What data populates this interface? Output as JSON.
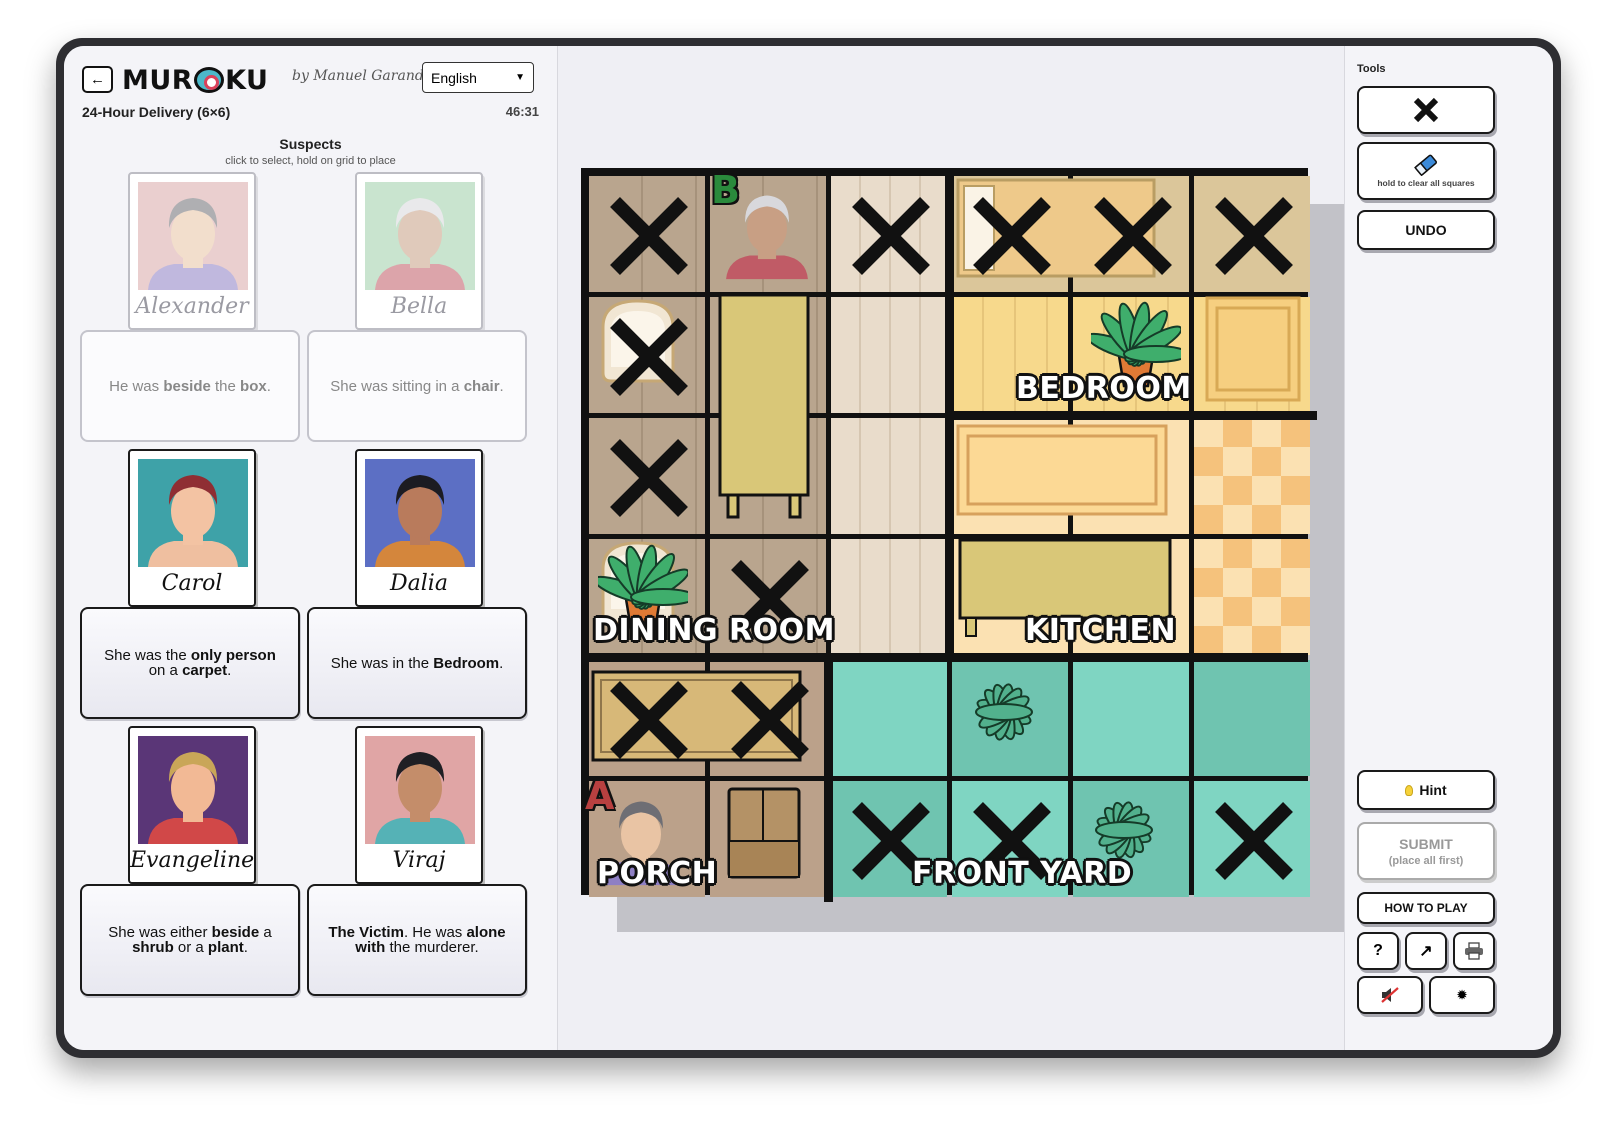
{
  "header": {
    "back_icon": "arrow-left-icon",
    "logo_left": "MUR",
    "logo_right": "KU",
    "byline": "by Manuel Garand",
    "language": "English",
    "puzzle_title": "24-Hour Delivery (6×6)",
    "timer": "46:31"
  },
  "suspects": {
    "heading": "Suspects",
    "subheading": "click to select, hold on grid to place",
    "cards": [
      {
        "name": "Alexander",
        "placed": true,
        "clue_html": "He was <b>beside</b> the <b>box</b>.",
        "bg": "#d9a9a9",
        "hair": "#6e6e74",
        "skin": "#e9c4a4",
        "shirt": "#8e7fc4"
      },
      {
        "name": "Bella",
        "placed": true,
        "clue_html": "She was sitting in a <b>chair</b>.",
        "bg": "#9dcfa8",
        "hair": "#d8d8dc",
        "skin": "#c89f84",
        "shirt": "#c05b66"
      },
      {
        "name": "Carol",
        "placed": false,
        "clue_html": "She was the <b>only person</b> on a <b>carpet</b>.",
        "bg": "#3ea2a8",
        "hair": "#8f2e33",
        "skin": "#f3c3a3",
        "shirt": "#efbfa0"
      },
      {
        "name": "Dalia",
        "placed": false,
        "clue_html": "She was in the <b>Bedroom</b>.",
        "bg": "#5c6fc4",
        "hair": "#1c1c22",
        "skin": "#b97b5c",
        "shirt": "#d4863c"
      },
      {
        "name": "Evangeline",
        "placed": false,
        "clue_html": "She was either <b>beside</b> a <b>shrub</b> or a <b>plant</b>.",
        "bg": "#5a3677",
        "hair": "#c9a658",
        "skin": "#f2b995",
        "shirt": "#d14848"
      },
      {
        "name": "Viraj",
        "placed": false,
        "clue_html": "<b>The Victim</b>. He was <b>alone with</b> the murderer.",
        "bg": "#e0a5a5",
        "hair": "#1f1f24",
        "skin": "#c48d6a",
        "shirt": "#55b2b6"
      }
    ]
  },
  "board": {
    "rooms": [
      {
        "label": "BEDROOM"
      },
      {
        "label": "DINING ROOM"
      },
      {
        "label": "KITCHEN"
      },
      {
        "label": "PORCH"
      },
      {
        "label": "FRONT YARD"
      }
    ],
    "tags": {
      "a": "A",
      "b": "B"
    },
    "x_marks": [
      [
        0,
        0
      ],
      [
        0,
        2
      ],
      [
        0,
        3
      ],
      [
        0,
        4
      ],
      [
        0,
        5
      ],
      [
        1,
        0
      ],
      [
        2,
        0
      ],
      [
        3,
        1
      ],
      [
        4,
        0
      ],
      [
        4,
        1
      ],
      [
        5,
        2
      ],
      [
        5,
        3
      ],
      [
        5,
        5
      ]
    ],
    "colors": {
      "wood": "#bba690",
      "dining": "#b9a58e",
      "bedroom": "#f7d98c",
      "kitchen_a": "#f5c27c",
      "kitchen_b": "#fbe1b2",
      "grass": "#7fd5c2",
      "grass_dark": "#6fc4b0"
    }
  },
  "tools": {
    "label": "Tools",
    "x_icon": "x-mark-icon",
    "eraser_icon": "eraser-icon",
    "eraser_caption": "hold to clear all squares",
    "undo": "UNDO",
    "hint": "Hint",
    "hint_icon": "lightbulb-icon",
    "submit": "SUBMIT",
    "submit_sub": "(place all first)",
    "how_to_play": "HOW TO PLAY",
    "help_icon": "?",
    "share_icon": "↗",
    "print_icon": "🖶",
    "mute_icon": "speaker-muted-icon",
    "settings_icon": "✹"
  }
}
